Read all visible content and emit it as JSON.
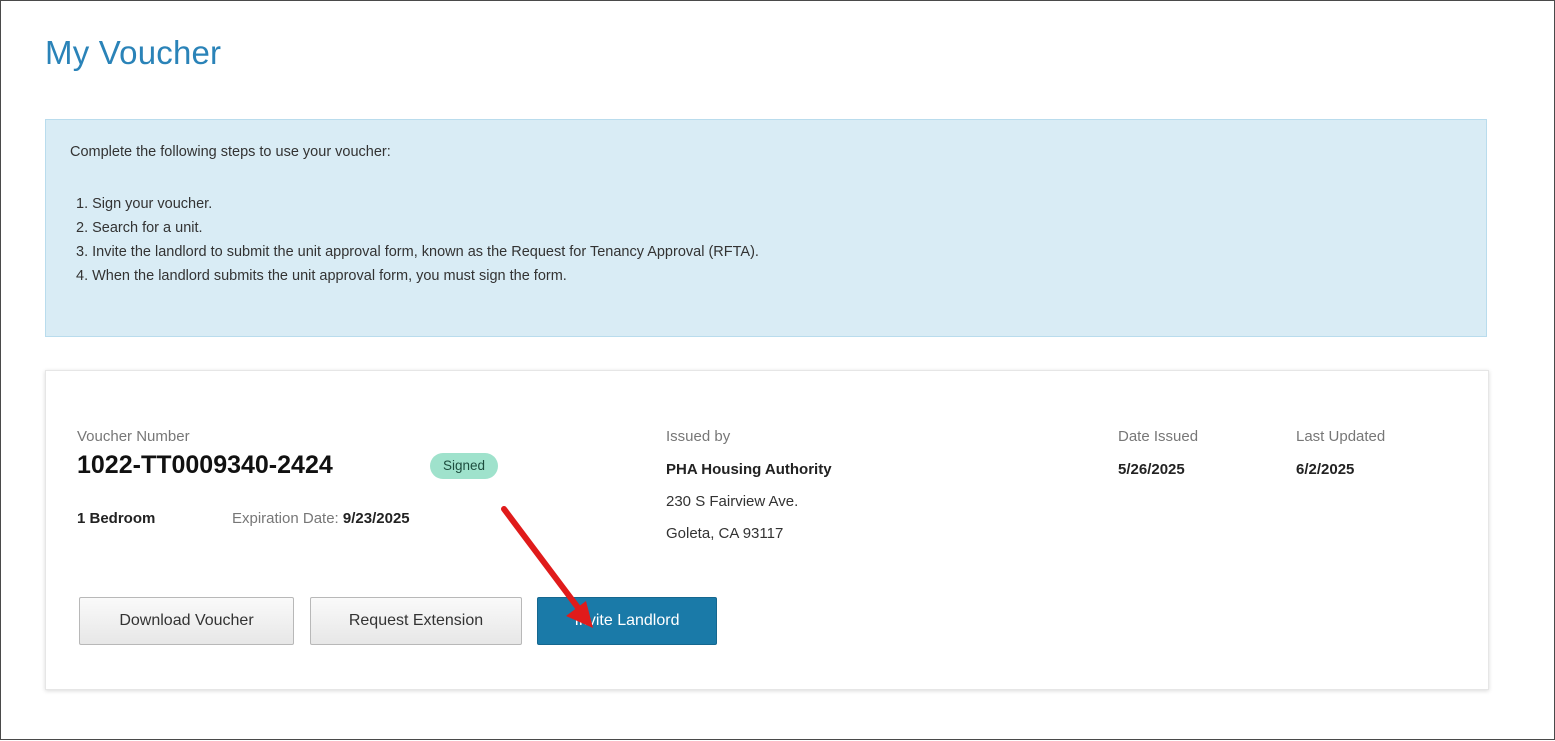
{
  "page": {
    "title": "My Voucher"
  },
  "info": {
    "intro": "Complete the following steps to use your voucher:",
    "steps": [
      "1. Sign your voucher.",
      "2. Search for a unit.",
      "3. Invite the landlord to submit the unit approval form, known as the Request for Tenancy Approval (RFTA).",
      "4. When the landlord submits the unit approval form, you must sign the form."
    ]
  },
  "voucher": {
    "number_label": "Voucher Number",
    "number": "1022-TT0009340-2424",
    "status": "Signed",
    "bedrooms": "1 Bedroom",
    "expiration_label": "Expiration Date:",
    "expiration_date": "9/23/2025",
    "issued_by_label": "Issued by",
    "issuer_name": "PHA Housing Authority",
    "issuer_address_line1": "230 S Fairview Ave.",
    "issuer_address_line2": "Goleta, CA 93117",
    "date_issued_label": "Date Issued",
    "date_issued": "5/26/2025",
    "last_updated_label": "Last Updated",
    "last_updated": "6/2/2025"
  },
  "actions": {
    "download_label": "Download Voucher",
    "extension_label": "Request Extension",
    "invite_label": "Invite Landlord"
  },
  "colors": {
    "title": "#2a83b8",
    "info_bg": "#d9ecf5",
    "badge_bg": "#9fe2cc",
    "primary_button": "#1a7aa8",
    "annotation_arrow": "#e01b1b"
  },
  "icons": {
    "annotation": "red-arrow-icon"
  }
}
